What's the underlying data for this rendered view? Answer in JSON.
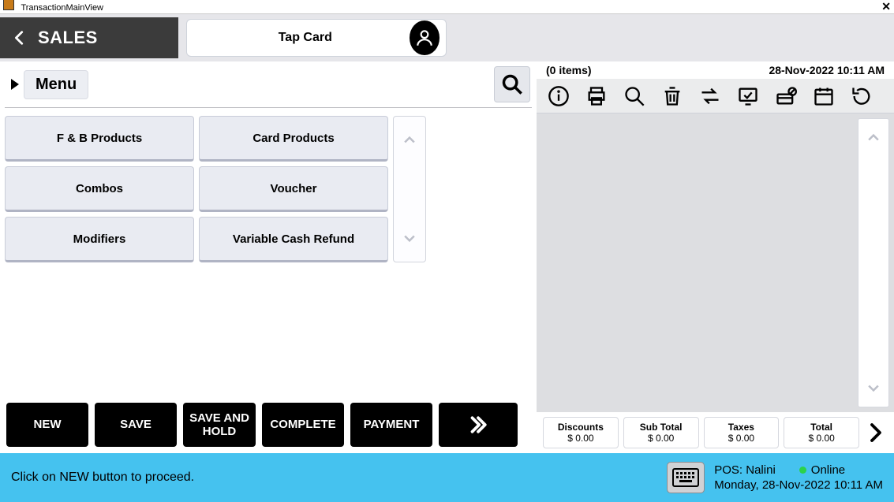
{
  "window": {
    "title": "TransactionMainView"
  },
  "topbar": {
    "sales": "SALES",
    "tap_card": "Tap Card"
  },
  "breadcrumb": {
    "menu": "Menu"
  },
  "categories": [
    "F & B Products",
    "Card Products",
    "Combos",
    "Voucher",
    "Modifiers",
    "Variable Cash Refund"
  ],
  "actions": {
    "new": "NEW",
    "save": "SAVE",
    "save_hold": "SAVE AND HOLD",
    "complete": "COMPLETE",
    "payment": "PAYMENT"
  },
  "ticket": {
    "items_summary": "(0 items)",
    "timestamp": "28-Nov-2022 10:11 AM"
  },
  "totals": {
    "discounts_label": "Discounts",
    "discounts_val": "$ 0.00",
    "subtotal_label": "Sub Total",
    "subtotal_val": "$ 0.00",
    "taxes_label": "Taxes",
    "taxes_val": "$ 0.00",
    "total_label": "Total",
    "total_val": "$ 0.00"
  },
  "footer": {
    "hint": "Click on NEW button to proceed.",
    "pos": "POS: Nalini",
    "online": "Online",
    "datetime": "Monday, 28-Nov-2022 10:11 AM"
  }
}
